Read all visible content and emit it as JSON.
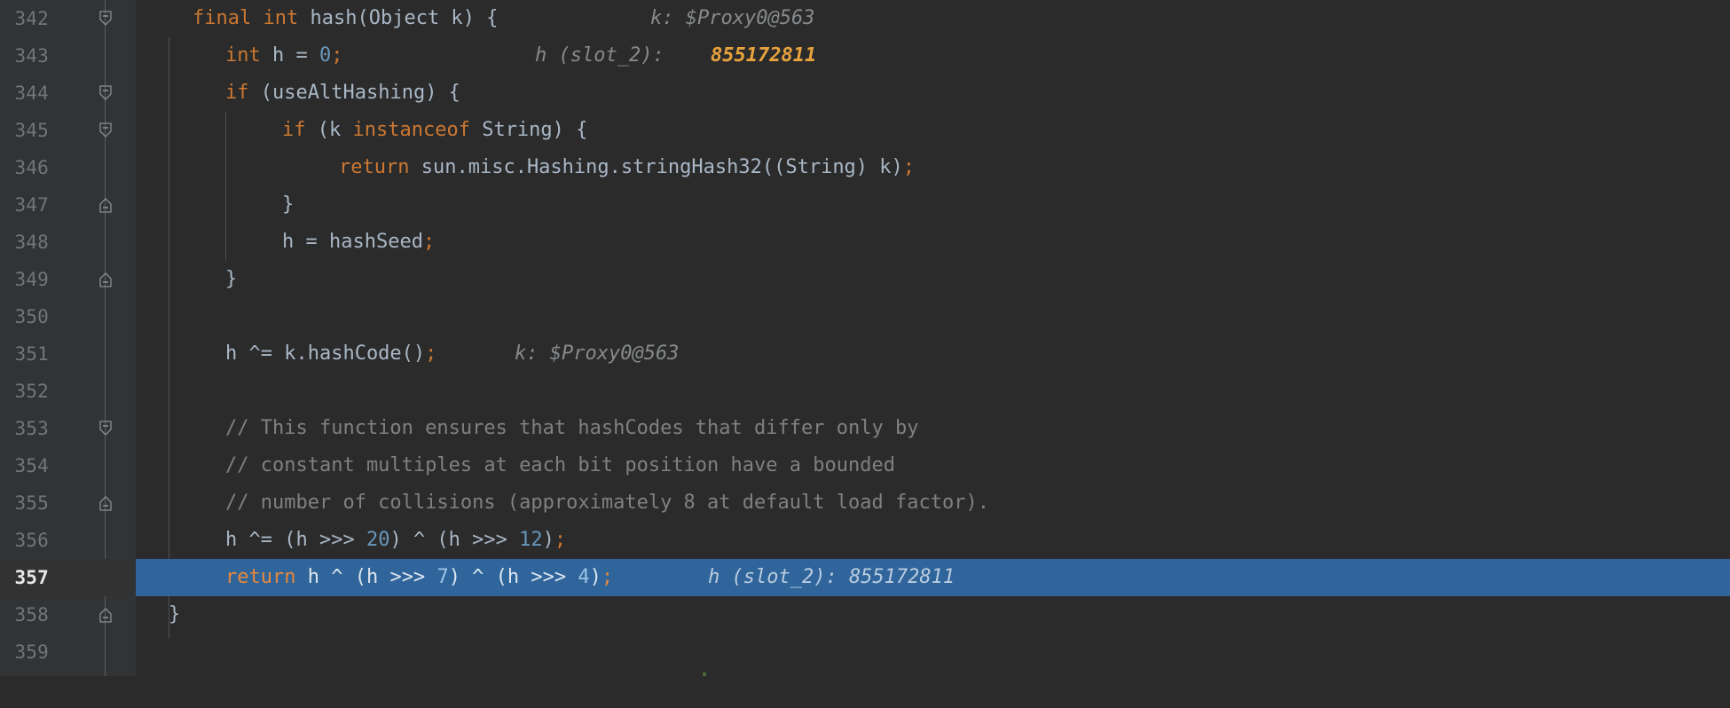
{
  "editor": {
    "theme": "darcula",
    "background": "#2b2b2b",
    "gutter_background": "#313335",
    "highlight_background": "#2f659b",
    "current_line_number": "357",
    "line_height_px": 42,
    "first_line": 342
  },
  "gutter": {
    "line_numbers": [
      "342",
      "343",
      "344",
      "345",
      "346",
      "347",
      "348",
      "349",
      "350",
      "351",
      "352",
      "353",
      "354",
      "355",
      "356",
      "357",
      "358",
      "359"
    ],
    "fold_markers": [
      {
        "line": "342",
        "type": "fold-start"
      },
      {
        "line": "344",
        "type": "fold-start"
      },
      {
        "line": "345",
        "type": "fold-start"
      },
      {
        "line": "347",
        "type": "fold-end"
      },
      {
        "line": "349",
        "type": "fold-end"
      },
      {
        "line": "353",
        "type": "fold-start"
      },
      {
        "line": "355",
        "type": "fold-end"
      },
      {
        "line": "358",
        "type": "fold-end"
      }
    ]
  },
  "colors": {
    "keyword": "#cc7832",
    "number": "#6897bb",
    "identifier": "#a9b7c6",
    "comment": "#808080",
    "inline_hint": "#868a8c",
    "inline_hint_value": "#e8a33d",
    "selection": "#2f659b",
    "line_number": "#707679"
  },
  "lines": [
    {
      "number": "342",
      "indent": 4,
      "code": "final int hash(Object k) {",
      "hint": "k: $Proxy0@563",
      "hint_value": "",
      "highlighted": false
    },
    {
      "number": "343",
      "indent": 8,
      "code": "int h = 0;",
      "hint": "h (slot_2):",
      "hint_value": "855172811",
      "highlighted": false
    },
    {
      "number": "344",
      "indent": 8,
      "code": "if (useAltHashing) {",
      "hint": "",
      "hint_value": "",
      "highlighted": false
    },
    {
      "number": "345",
      "indent": 12,
      "code": "if (k instanceof String) {",
      "hint": "",
      "hint_value": "",
      "highlighted": false
    },
    {
      "number": "346",
      "indent": 16,
      "code": "return sun.misc.Hashing.stringHash32((String) k);",
      "hint": "",
      "hint_value": "",
      "highlighted": false
    },
    {
      "number": "347",
      "indent": 12,
      "code": "}",
      "hint": "",
      "hint_value": "",
      "highlighted": false
    },
    {
      "number": "348",
      "indent": 12,
      "code": "h = hashSeed;",
      "hint": "",
      "hint_value": "",
      "highlighted": false
    },
    {
      "number": "349",
      "indent": 8,
      "code": "}",
      "hint": "",
      "hint_value": "",
      "highlighted": false
    },
    {
      "number": "350",
      "indent": 0,
      "code": "",
      "hint": "",
      "hint_value": "",
      "highlighted": false
    },
    {
      "number": "351",
      "indent": 8,
      "code": "h ^= k.hashCode();",
      "hint": "k: $Proxy0@563",
      "hint_value": "",
      "highlighted": false
    },
    {
      "number": "352",
      "indent": 0,
      "code": "",
      "hint": "",
      "hint_value": "",
      "highlighted": false
    },
    {
      "number": "353",
      "indent": 8,
      "code": "// This function ensures that hashCodes that differ only by",
      "hint": "",
      "hint_value": "",
      "highlighted": false
    },
    {
      "number": "354",
      "indent": 8,
      "code": "// constant multiples at each bit position have a bounded",
      "hint": "",
      "hint_value": "",
      "highlighted": false
    },
    {
      "number": "355",
      "indent": 8,
      "code": "// number of collisions (approximately 8 at default load factor).",
      "hint": "",
      "hint_value": "",
      "highlighted": false
    },
    {
      "number": "356",
      "indent": 8,
      "code": "h ^= (h >>> 20) ^ (h >>> 12);",
      "hint": "",
      "hint_value": "",
      "highlighted": false
    },
    {
      "number": "357",
      "indent": 8,
      "code": "return h ^ (h >>> 7) ^ (h >>> 4);",
      "hint": "h (slot_2): 855172811",
      "hint_value": "",
      "highlighted": true
    },
    {
      "number": "358",
      "indent": 4,
      "code": "}",
      "hint": "",
      "hint_value": "",
      "highlighted": false
    },
    {
      "number": "359",
      "indent": 0,
      "code": "",
      "hint": "",
      "hint_value": "",
      "highlighted": false
    }
  ],
  "code_html": {
    "l342": "<span class=\"kw\">final</span> <span class=\"kw\">int</span> <span class=\"ident\">hash</span><span class=\"punct\">(</span><span class=\"ident\">Object k</span><span class=\"punct\">) {</span>",
    "l343": "<span class=\"kw\">int</span> <span class=\"ident\">h = </span><span class=\"num\">0</span><span class=\"semi\">;</span>",
    "l344": "<span class=\"kw\">if</span> <span class=\"punct\">(</span><span class=\"ident\">useAltHashing</span><span class=\"punct\">) {</span>",
    "l345": "<span class=\"kw\">if</span> <span class=\"punct\">(</span><span class=\"ident\">k </span><span class=\"kw\">instanceof</span><span class=\"ident\"> String</span><span class=\"punct\">) {</span>",
    "l346": "<span class=\"kw\">return</span> <span class=\"ident\">sun.misc.Hashing.stringHash32((String) k)</span><span class=\"semi\">;</span>",
    "l347": "<span class=\"punct\">}</span>",
    "l348": "<span class=\"ident\">h = hashSeed</span><span class=\"semi\">;</span>",
    "l349": "<span class=\"punct\">}</span>",
    "l351": "<span class=\"ident\">h ^= k.hashCode()</span><span class=\"semi\">;</span>",
    "l356": "<span class=\"ident\">h ^= (h &gt;&gt;&gt; </span><span class=\"num\">20</span><span class=\"ident\">) ^ (h &gt;&gt;&gt; </span><span class=\"num\">12</span><span class=\"ident\">)</span><span class=\"semi\">;</span>",
    "l357": "<span class=\"kw\">return</span><span class=\"ident\"> h ^ (h &gt;&gt;&gt; </span><span class=\"num\">7</span><span class=\"ident\">) ^ (h &gt;&gt;&gt; </span><span class=\"num\">4</span><span class=\"ident\">)</span><span class=\"semi\">;</span>",
    "l358": "<span class=\"punct\">}</span>"
  }
}
